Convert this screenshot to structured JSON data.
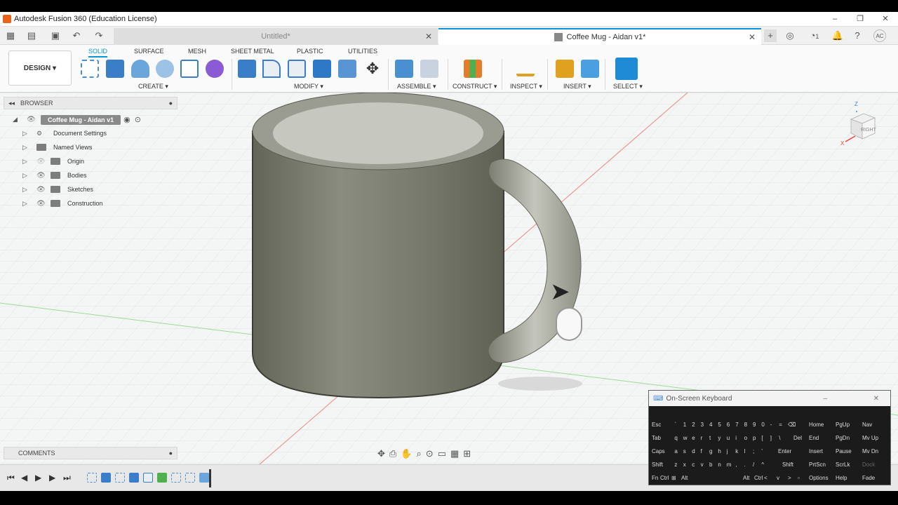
{
  "window": {
    "title": "Autodesk Fusion 360 (Education License)",
    "minimize": "–",
    "maximize": "❐",
    "close": "✕"
  },
  "tabs": [
    {
      "label": "Untitled*",
      "close": "✕"
    },
    {
      "label": "Coffee Mug - Aidan v1*",
      "close": "✕"
    }
  ],
  "user_initials": "AC",
  "notifications_count": "1",
  "design_button": "DESIGN ▾",
  "ribbon_tabs": [
    "SOLID",
    "SURFACE",
    "MESH",
    "SHEET METAL",
    "PLASTIC",
    "UTILITIES"
  ],
  "groups": {
    "create": "CREATE ▾",
    "modify": "MODIFY ▾",
    "assemble": "ASSEMBLE ▾",
    "construct": "CONSTRUCT ▾",
    "inspect": "INSPECT ▾",
    "insert": "INSERT ▾",
    "select": "SELECT ▾"
  },
  "browser": {
    "title": "BROWSER",
    "root": "Coffee Mug - Aidan v1",
    "items": [
      "Document Settings",
      "Named Views",
      "Origin",
      "Bodies",
      "Sketches",
      "Construction"
    ]
  },
  "comments_label": "COMMENTS",
  "viewcube_label": "RIGHT",
  "axis": {
    "z": "Z",
    "x": "X"
  },
  "osk": {
    "title": "On-Screen Keyboard",
    "row1": [
      "Esc",
      "`",
      "1",
      "2",
      "3",
      "4",
      "5",
      "6",
      "7",
      "8",
      "9",
      "0",
      "-",
      "=",
      "⌫"
    ],
    "row2": [
      "Tab",
      "q",
      "w",
      "e",
      "r",
      "t",
      "y",
      "u",
      "i",
      "o",
      "p",
      "[",
      "]",
      "\\",
      "Del"
    ],
    "row3": [
      "Caps",
      "a",
      "s",
      "d",
      "f",
      "g",
      "h",
      "j",
      "k",
      "l",
      ";",
      "'",
      "Enter"
    ],
    "row4": [
      "Shift",
      "z",
      "x",
      "c",
      "v",
      "b",
      "n",
      "m",
      ",",
      ".",
      "/",
      "^",
      "Shift"
    ],
    "row5": [
      "Fn",
      "Ctrl",
      "⊞",
      "Alt",
      "Alt",
      "Ctrl",
      "<",
      "v",
      ">",
      "▫"
    ],
    "nav": [
      [
        "Home",
        "PgUp",
        "Nav"
      ],
      [
        "End",
        "PgDn",
        "Mv Up"
      ],
      [
        "Insert",
        "Pause",
        "Mv Dn"
      ],
      [
        "PrtScn",
        "ScrLk",
        "Dock"
      ],
      [
        "Options",
        "Help",
        "Fade"
      ]
    ]
  }
}
